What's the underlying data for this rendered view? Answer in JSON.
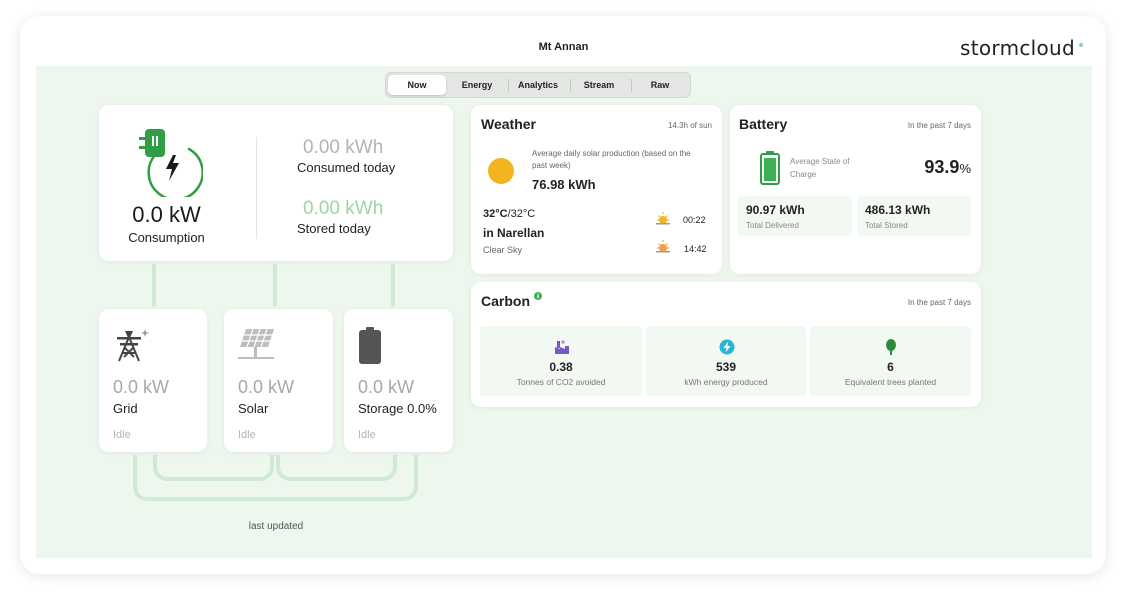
{
  "header": {
    "site_name": "Mt Annan",
    "brand": "stormcloud"
  },
  "tabs": [
    {
      "label": "Now",
      "active": true
    },
    {
      "label": "Energy",
      "active": false
    },
    {
      "label": "Analytics",
      "active": false
    },
    {
      "label": "Stream",
      "active": false
    },
    {
      "label": "Raw",
      "active": false
    }
  ],
  "consumption": {
    "value": "0.0 kW",
    "label": "Consumption",
    "consumed_value": "0.00 kWh",
    "consumed_label": "Consumed today",
    "stored_value": "0.00 kWh",
    "stored_label": "Stored today",
    "icon": "plug-bolt-icon"
  },
  "sources": [
    {
      "key": "grid",
      "value": "0.0 kW",
      "label": "Grid",
      "status": "Idle",
      "icon": "power-tower-icon"
    },
    {
      "key": "solar",
      "value": "0.0 kW",
      "label": "Solar",
      "status": "Idle",
      "icon": "solar-panel-icon"
    },
    {
      "key": "storage",
      "value": "0.0 kW",
      "label": "Storage 0.0%",
      "status": "Idle",
      "icon": "battery-icon"
    }
  ],
  "footer": {
    "last_updated": "last updated"
  },
  "weather": {
    "title": "Weather",
    "sun_hours": "14.3h of sun",
    "solar_desc": "Average daily solar production (based on the past week)",
    "solar_value": "76.98 kWh",
    "temp_high": "32°C",
    "temp_sep": "/32°C",
    "location": "in Narellan",
    "condition": "Clear Sky",
    "sunrise": "00:22",
    "sunset": "14:42"
  },
  "battery": {
    "title": "Battery",
    "period": "In the past 7 days",
    "soc_label": "Average State of Charge",
    "soc_value": "93.9",
    "soc_unit": "%",
    "delivered_value": "90.97 kWh",
    "delivered_label": "Total Delivered",
    "stored_value": "486.13 kWh",
    "stored_label": "Total Stored"
  },
  "carbon": {
    "title": "Carbon",
    "period": "In the past 7 days",
    "stats": [
      {
        "value": "0.38",
        "label": "Tonnes of CO2 avoided",
        "icon": "factory-icon"
      },
      {
        "value": "539",
        "label": "kWh energy produced",
        "icon": "lightning-icon"
      },
      {
        "value": "6",
        "label": "Equivalent trees planted",
        "icon": "tree-icon"
      }
    ]
  },
  "colors": {
    "accent": "#2f9e44",
    "panel_bg": "#edf7ee",
    "connector": "#cfe9d3",
    "sun": "#f2b51f"
  }
}
